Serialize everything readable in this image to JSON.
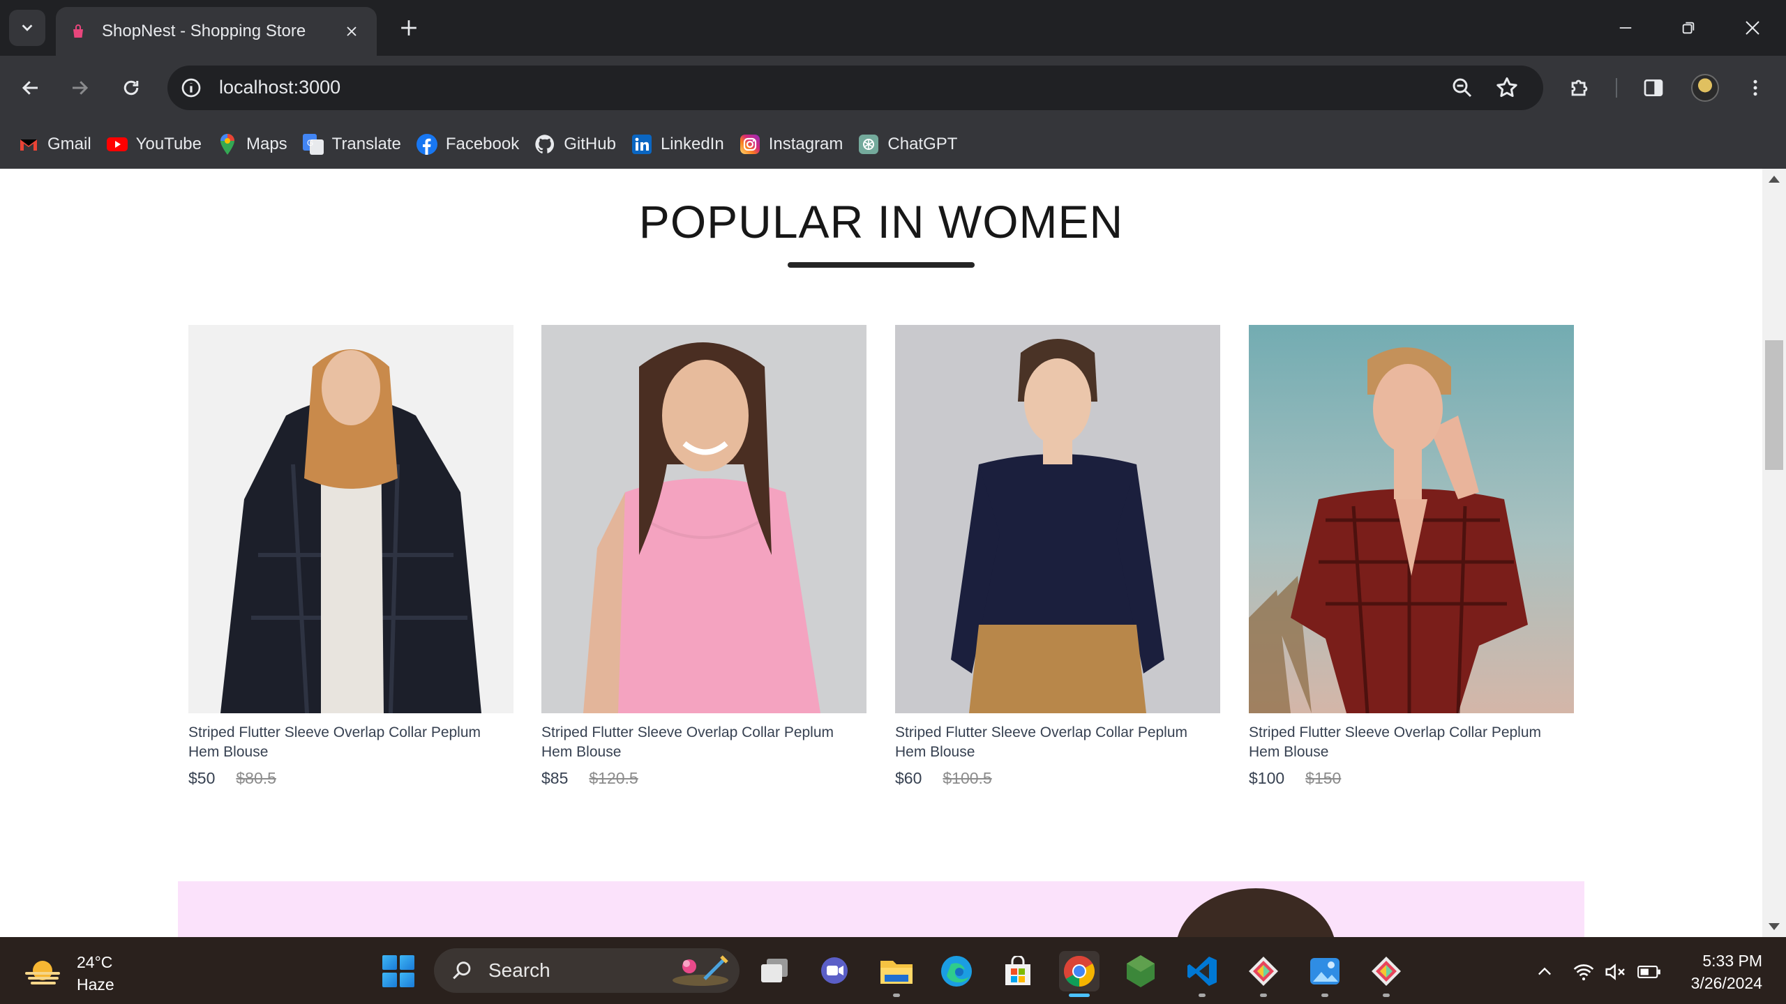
{
  "browser": {
    "tab_title": "ShopNest - Shopping Store",
    "url": "localhost:3000",
    "bookmarks": [
      {
        "label": "Gmail",
        "icon": "gmail-icon"
      },
      {
        "label": "YouTube",
        "icon": "youtube-icon"
      },
      {
        "label": "Maps",
        "icon": "maps-icon"
      },
      {
        "label": "Translate",
        "icon": "translate-icon"
      },
      {
        "label": "Facebook",
        "icon": "facebook-icon"
      },
      {
        "label": "GitHub",
        "icon": "github-icon"
      },
      {
        "label": "LinkedIn",
        "icon": "linkedin-icon"
      },
      {
        "label": "Instagram",
        "icon": "instagram-icon"
      },
      {
        "label": "ChatGPT",
        "icon": "chatgpt-icon"
      }
    ]
  },
  "page": {
    "section_title": "POPULAR IN WOMEN",
    "products": [
      {
        "name": "Striped Flutter Sleeve Overlap Collar Peplum Hem Blouse",
        "new_price": "$50",
        "old_price": "$80.5",
        "image": "woman-in-black-fur-jacket"
      },
      {
        "name": "Striped Flutter Sleeve Overlap Collar Peplum Hem Blouse",
        "new_price": "$85",
        "old_price": "$120.5",
        "image": "woman-in-pink-top"
      },
      {
        "name": "Striped Flutter Sleeve Overlap Collar Peplum Hem Blouse",
        "new_price": "$60",
        "old_price": "$100.5",
        "image": "woman-in-navy-sweater"
      },
      {
        "name": "Striped Flutter Sleeve Overlap Collar Peplum Hem Blouse",
        "new_price": "$100",
        "old_price": "$150",
        "image": "woman-in-red-blouse"
      }
    ]
  },
  "taskbar": {
    "weather_temp": "24°C",
    "weather_desc": "Haze",
    "search_label": "Search",
    "time": "5:33 PM",
    "date": "3/26/2024"
  },
  "colors": {
    "chrome_dark": "#202124",
    "chrome_toolbar": "#35363a",
    "banner_pink": "#fbe2fb",
    "price_text": "#374151",
    "old_price": "#8c8c8c"
  }
}
